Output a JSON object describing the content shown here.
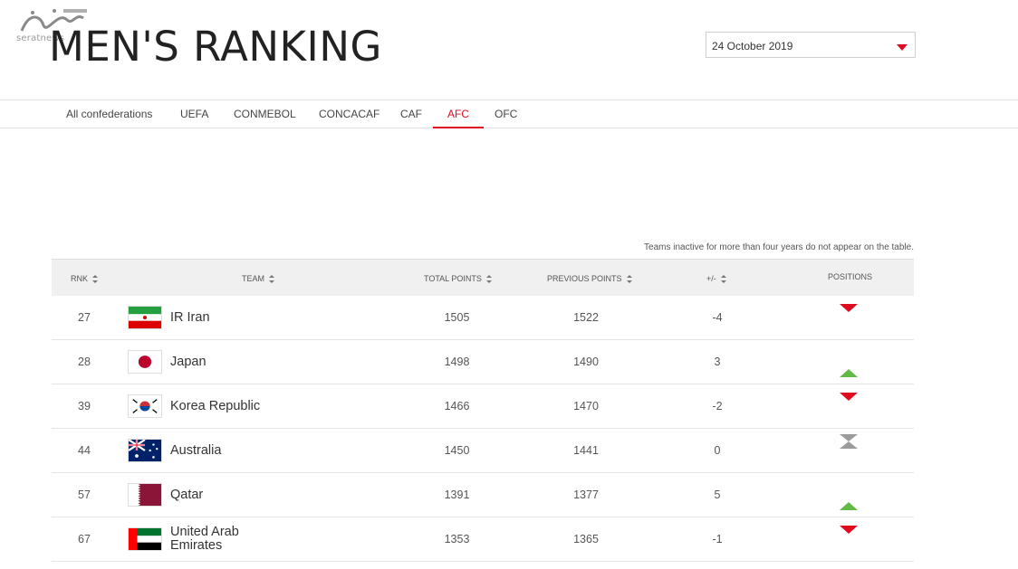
{
  "watermark": {
    "text": "seratnews"
  },
  "header": {
    "title": "MEN'S RANKING"
  },
  "date_select": {
    "value": "24 October 2019"
  },
  "tabs": [
    {
      "label": "All confederations",
      "active": false
    },
    {
      "label": "UEFA",
      "active": false
    },
    {
      "label": "CONMEBOL",
      "active": false
    },
    {
      "label": "CONCACAF",
      "active": false
    },
    {
      "label": "CAF",
      "active": false
    },
    {
      "label": "AFC",
      "active": true
    },
    {
      "label": "OFC",
      "active": false
    }
  ],
  "note": "Teams inactive for more than four years do not appear on the table.",
  "table": {
    "columns": {
      "rank": "RNK",
      "team": "TEAM",
      "total": "TOTAL POINTS",
      "previous": "PREVIOUS POINTS",
      "diff": "+/-",
      "positions": "POSITIONS"
    },
    "rows": [
      {
        "rank": "27",
        "team": "IR Iran",
        "flag": "iran-flag-icon",
        "total": "1505",
        "previous": "1522",
        "diff": "-4",
        "movement": "down"
      },
      {
        "rank": "28",
        "team": "Japan",
        "flag": "japan-flag-icon",
        "total": "1498",
        "previous": "1490",
        "diff": "3",
        "movement": "up"
      },
      {
        "rank": "39",
        "team": "Korea Republic",
        "flag": "korea-flag-icon",
        "total": "1466",
        "previous": "1470",
        "diff": "-2",
        "movement": "down"
      },
      {
        "rank": "44",
        "team": "Australia",
        "flag": "australia-flag-icon",
        "total": "1450",
        "previous": "1441",
        "diff": "0",
        "movement": "same"
      },
      {
        "rank": "57",
        "team": "Qatar",
        "flag": "qatar-flag-icon",
        "total": "1391",
        "previous": "1377",
        "diff": "5",
        "movement": "up"
      },
      {
        "rank": "67",
        "team": "United Arab Emirates",
        "flag": "uae-flag-icon",
        "total": "1353",
        "previous": "1365",
        "diff": "-1",
        "movement": "down"
      }
    ]
  },
  "colors": {
    "accent": "#e00b1e",
    "up": "#62b946",
    "same": "#9b9b9b"
  }
}
